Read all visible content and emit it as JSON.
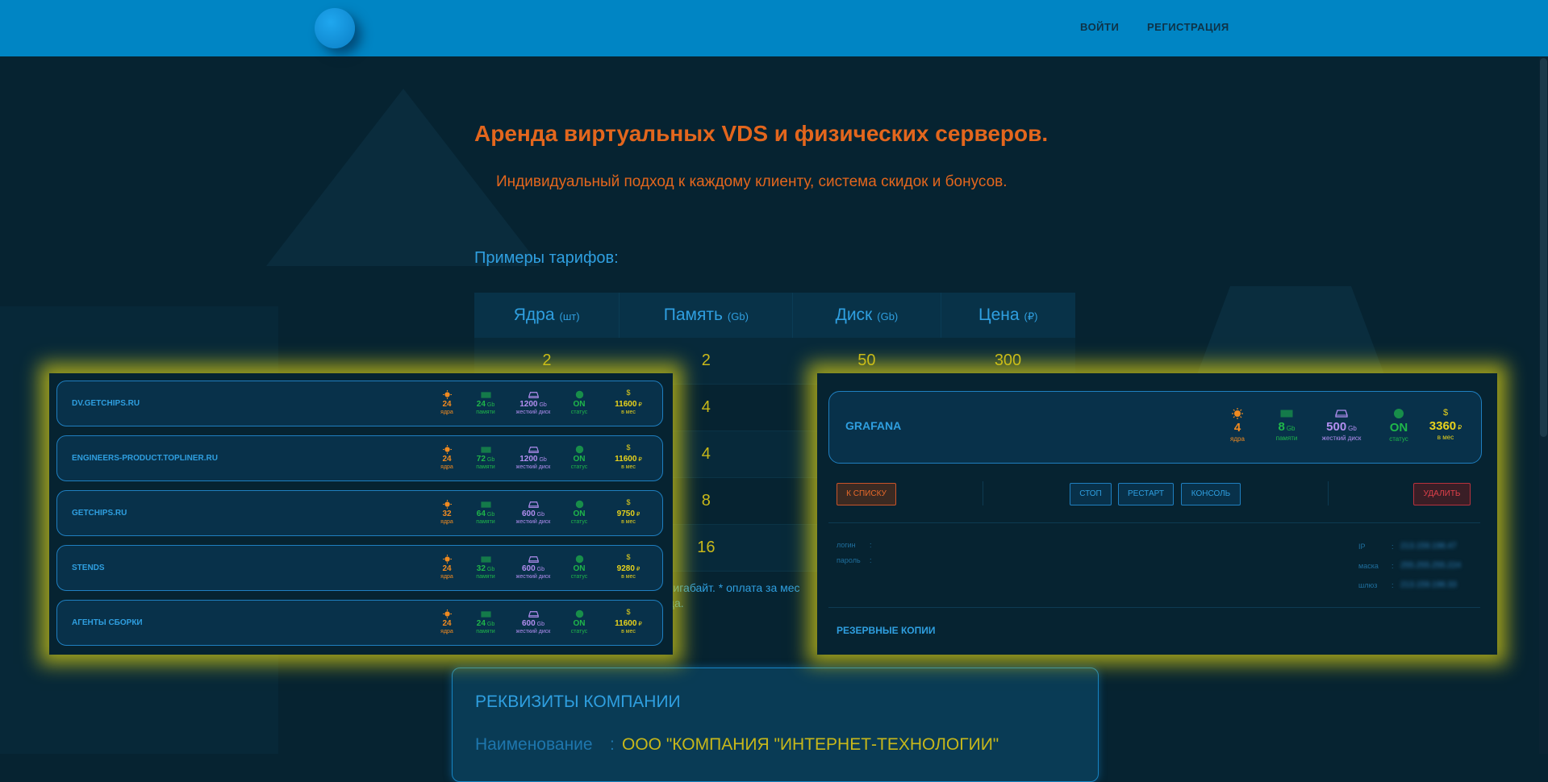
{
  "header": {
    "nav_login": "ВОЙТИ",
    "nav_register": "РЕГИСТРАЦИЯ"
  },
  "hero": {
    "title": "Аренда виртуальных VDS и физических серверов.",
    "subtitle": "Индивидуальный подход к каждому клиенту, система скидок и бонусов."
  },
  "tariffs": {
    "heading": "Примеры тарифов:",
    "columns": [
      {
        "label": "Ядра",
        "unit": "(шт)"
      },
      {
        "label": "Память",
        "unit": "(Gb)"
      },
      {
        "label": "Диск",
        "unit": "(Gb)"
      },
      {
        "label": "Цена",
        "unit": "(₽)"
      }
    ],
    "rows": [
      [
        "2",
        "2",
        "50",
        "300"
      ],
      [
        "",
        "4",
        "",
        ""
      ],
      [
        "",
        "4",
        "",
        ""
      ],
      [
        "",
        "8",
        "",
        ""
      ],
      [
        "",
        "16",
        "",
        ""
      ]
    ],
    "note_line1": "тигабайт. * оплата за мес",
    "note_line2": "ца."
  },
  "company": {
    "title": "РЕКВИЗИТЫ КОМПАНИИ",
    "name_label": "Наименование",
    "name_sep": ":",
    "name_value": "ООО \"КОМПАНИЯ \"ИНТЕРНЕТ-ТЕХНОЛОГИИ\""
  },
  "captions": {
    "cores": "ядра",
    "memory": "памяти",
    "disk": "жесткий диск",
    "status": "статус",
    "price": "в мес",
    "gb": "Gb",
    "rub": "₽"
  },
  "servers": [
    {
      "name": "DV.GETCHIPS.RU",
      "cores": "24",
      "memory": "24",
      "disk": "1200",
      "status": "ON",
      "price": "11600"
    },
    {
      "name": "ENGINEERS-PRODUCT.TOPLINER.RU",
      "cores": "24",
      "memory": "72",
      "disk": "1200",
      "status": "ON",
      "price": "11600"
    },
    {
      "name": "GETCHIPS.RU",
      "cores": "32",
      "memory": "64",
      "disk": "600",
      "status": "ON",
      "price": "9750"
    },
    {
      "name": "STENDS",
      "cores": "24",
      "memory": "32",
      "disk": "600",
      "status": "ON",
      "price": "9280"
    },
    {
      "name": "АГЕНТЫ СБОРКИ",
      "cores": "24",
      "memory": "24",
      "disk": "600",
      "status": "ON",
      "price": "11600"
    }
  ],
  "detail": {
    "name": "GRAFANA",
    "cores": "4",
    "memory": "8",
    "disk": "500",
    "status": "ON",
    "price": "3360",
    "btn_back": "К СПИСКУ",
    "btn_stop": "СТОП",
    "btn_restart": "РЕСТАРТ",
    "btn_console": "КОНСОЛЬ",
    "btn_delete": "УДАЛИТЬ",
    "login_label": "логин",
    "password_label": "пароль",
    "ip_label": "IP",
    "mask_label": "маска",
    "gateway_label": "шлюз",
    "sep": ":",
    "ip_value": "213.159.198.47",
    "mask_value": "255.255.255.224",
    "gateway_value": "213.159.198.33",
    "backups_title": "РЕЗЕРВНЫЕ КОПИИ"
  },
  "colors": {
    "header": "#0085c4",
    "background": "#062331",
    "accent_blue": "#2f9fe0",
    "orange": "#e3661d",
    "yellow": "#c8b81a",
    "highlight_glow": "#d2c814"
  }
}
